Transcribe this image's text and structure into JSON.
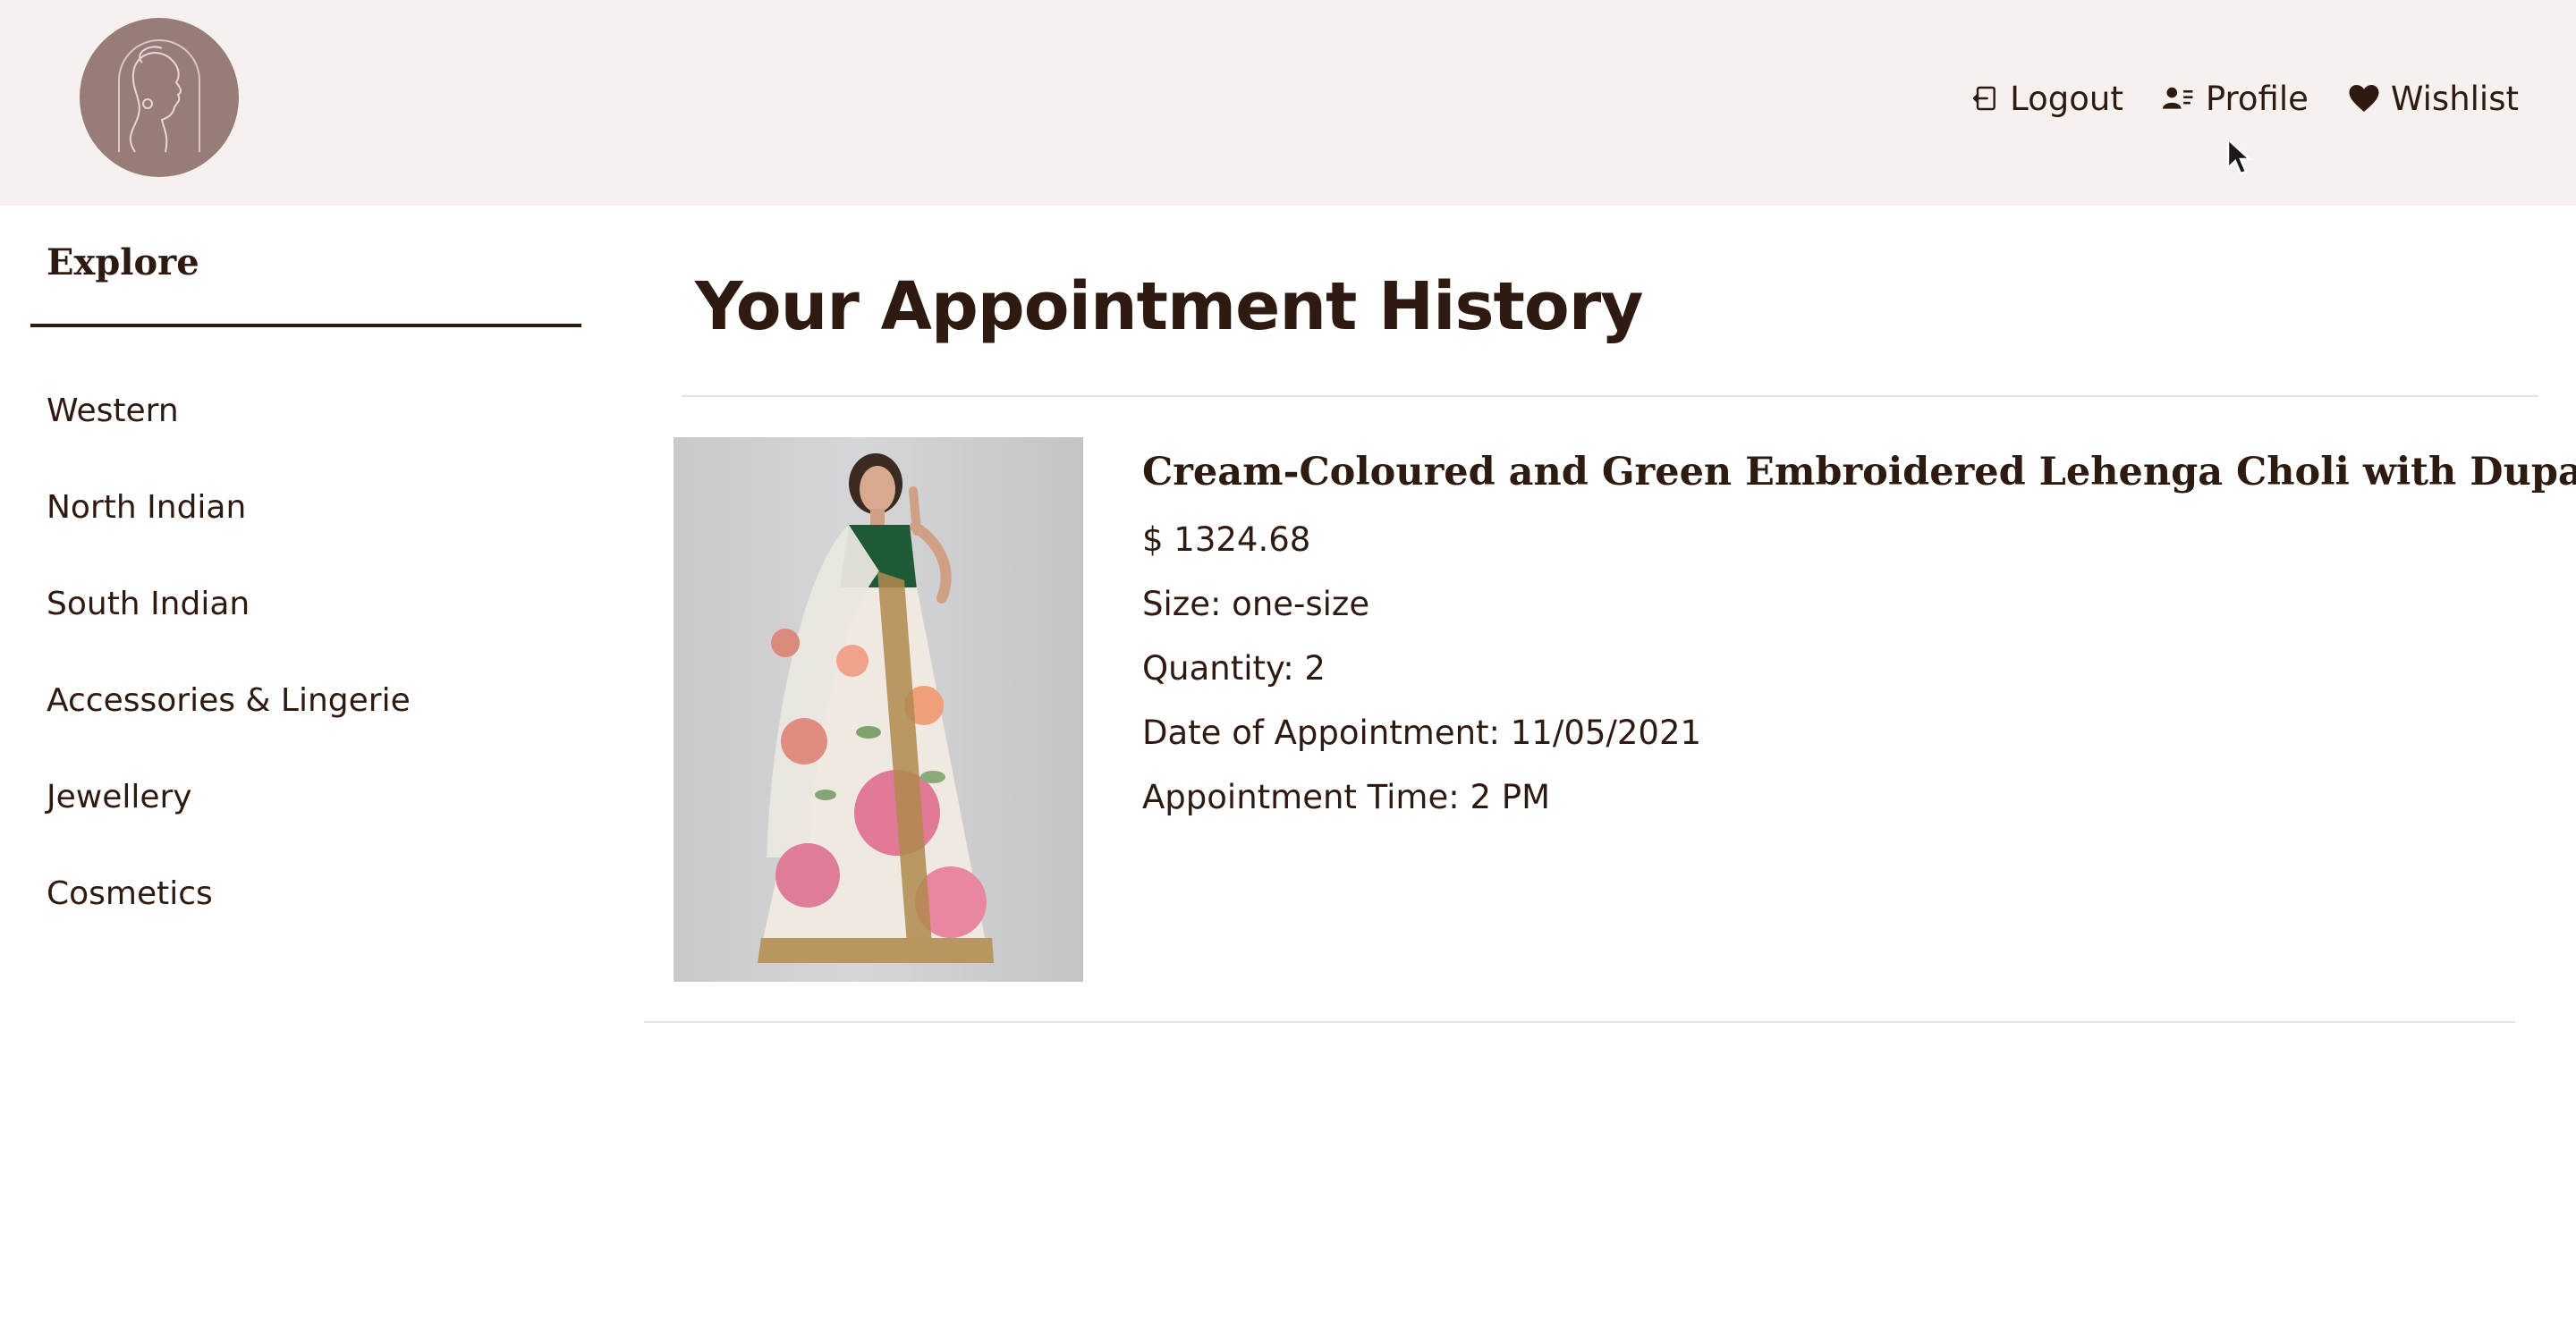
{
  "header": {
    "logo_icon": "woman-profile-logo",
    "nav": [
      {
        "label": "Logout",
        "icon": "logout-icon"
      },
      {
        "label": "Profile",
        "icon": "profile-card-icon"
      },
      {
        "label": "Wishlist",
        "icon": "heart-icon"
      }
    ]
  },
  "sidebar": {
    "title": "Explore",
    "items": [
      {
        "label": "Western"
      },
      {
        "label": "North Indian"
      },
      {
        "label": "South Indian"
      },
      {
        "label": "Accessories & Lingerie"
      },
      {
        "label": "Jewellery"
      },
      {
        "label": "Cosmetics"
      }
    ]
  },
  "main": {
    "title": "Your Appointment History",
    "appointments": [
      {
        "name": "Cream-Coloured and Green Embroidered Lehenga Choli with Dupatta",
        "price": "$ 1324.68",
        "size": "Size: one-size",
        "quantity": "Quantity: 2",
        "date": "Date of Appointment: 11/05/2021",
        "time": "Appointment Time: 2 PM"
      }
    ]
  },
  "colors": {
    "header_bg": "#f6f0ef",
    "text": "#2e1a10",
    "logo_bg": "#987c78",
    "divider": "#e6e2e1"
  }
}
